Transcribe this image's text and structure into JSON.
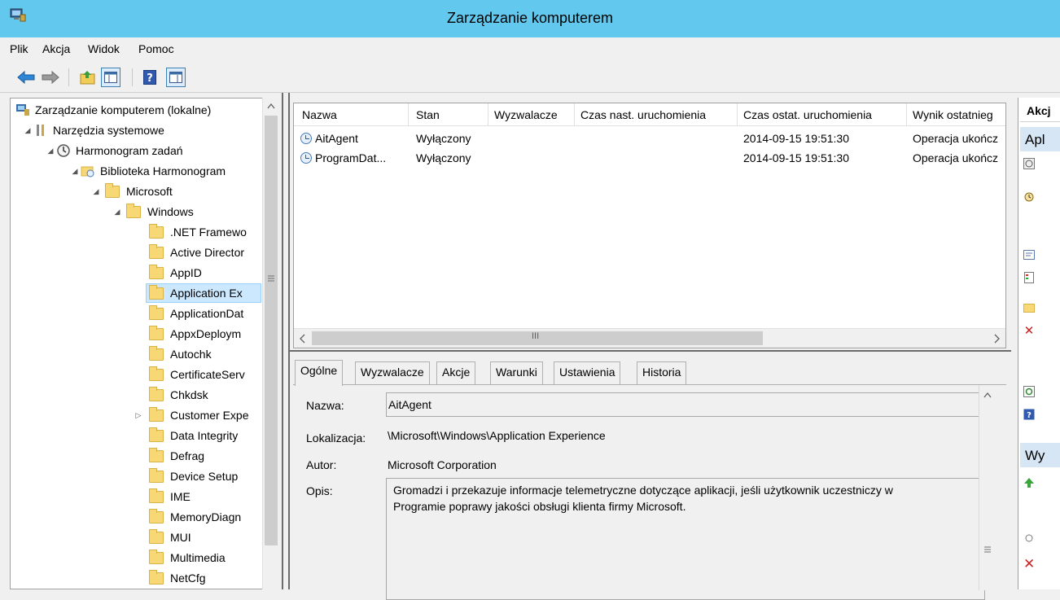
{
  "window": {
    "title": "Zarządzanie komputerem"
  },
  "menu": [
    "Plik",
    "Akcja",
    "Widok",
    "Pomoc"
  ],
  "toolbar": {
    "buttons": [
      "back-arrow-icon",
      "forward-arrow-icon",
      "up-folder-icon",
      "show-hide-tree-icon",
      "help-icon",
      "show-hide-action-pane-icon"
    ]
  },
  "tree": {
    "items": [
      {
        "label": "Zarządzanie komputerem (lokalne)",
        "expander": "",
        "icon": "computer-management-icon"
      },
      {
        "label": "Narzędzia systemowe",
        "expander": "◢",
        "icon": "tools-icon"
      },
      {
        "label": "Harmonogram zadań",
        "expander": "◢",
        "icon": "task-scheduler-icon"
      },
      {
        "label": "Biblioteka Harmonogram",
        "expander": "◢",
        "icon": "library-folder-icon"
      },
      {
        "label": "Microsoft",
        "expander": "◢",
        "icon": "folder-icon"
      },
      {
        "label": "Windows",
        "expander": "◢",
        "icon": "folder-icon"
      },
      {
        "label": ".NET Framewo",
        "expander": "",
        "icon": "folder-icon"
      },
      {
        "label": "Active Director",
        "expander": "",
        "icon": "folder-icon"
      },
      {
        "label": "AppID",
        "expander": "",
        "icon": "folder-icon"
      },
      {
        "label": "Application Ex",
        "expander": "",
        "icon": "folder-icon"
      },
      {
        "label": "ApplicationDat",
        "expander": "",
        "icon": "folder-icon"
      },
      {
        "label": "AppxDeploym",
        "expander": "",
        "icon": "folder-icon"
      },
      {
        "label": "Autochk",
        "expander": "",
        "icon": "folder-icon"
      },
      {
        "label": "CertificateServ",
        "expander": "",
        "icon": "folder-icon"
      },
      {
        "label": "Chkdsk",
        "expander": "",
        "icon": "folder-icon"
      },
      {
        "label": "Customer Expe",
        "expander": "▷",
        "icon": "folder-icon"
      },
      {
        "label": "Data Integrity",
        "expander": "",
        "icon": "folder-icon"
      },
      {
        "label": "Defrag",
        "expander": "",
        "icon": "folder-icon"
      },
      {
        "label": "Device Setup",
        "expander": "",
        "icon": "folder-icon"
      },
      {
        "label": "IME",
        "expander": "",
        "icon": "folder-icon"
      },
      {
        "label": "MemoryDiagn",
        "expander": "",
        "icon": "folder-icon"
      },
      {
        "label": "MUI",
        "expander": "",
        "icon": "folder-icon"
      },
      {
        "label": "Multimedia",
        "expander": "",
        "icon": "folder-icon"
      },
      {
        "label": "NetCfg",
        "expander": "",
        "icon": "folder-icon"
      }
    ]
  },
  "list": {
    "columns": [
      "Nazwa",
      "Stan",
      "Wyzwalacze",
      "Czas nast. uruchomienia",
      "Czas ostat. uruchomienia",
      "Wynik ostatnieg"
    ],
    "rows": [
      {
        "name": "AitAgent",
        "state": "Wyłączony",
        "triggers": "",
        "next_run": "",
        "last_run": "2014-09-15 19:51:30",
        "result": "Operacja ukończ"
      },
      {
        "name": "ProgramDat...",
        "state": "Wyłączony",
        "triggers": "",
        "next_run": "",
        "last_run": "2014-09-15 19:51:30",
        "result": "Operacja ukończ"
      }
    ],
    "scroll_mark": "III"
  },
  "tabs": [
    "Ogólne",
    "Wyzwalacze",
    "Akcje",
    "Warunki",
    "Ustawienia",
    "Historia"
  ],
  "details": {
    "name_label": "Nazwa:",
    "name_value": "AitAgent",
    "location_label": "Lokalizacja:",
    "location_value": "\\Microsoft\\Windows\\Application Experience",
    "author_label": "Autor:",
    "author_value": "Microsoft Corporation",
    "desc_label": "Opis:",
    "desc_line1": "Gromadzi i przekazuje informacje telemetryczne dotyczące aplikacji, jeśli użytkownik uczestniczy w",
    "desc_line2": "Programie poprawy jakości obsługi klienta firmy Microsoft."
  },
  "actions": {
    "header": "Akcj",
    "section1": "Apl",
    "section2": "Wy"
  },
  "colors": {
    "titlebar": "#63c8ee",
    "selection": "#cce8ff"
  }
}
